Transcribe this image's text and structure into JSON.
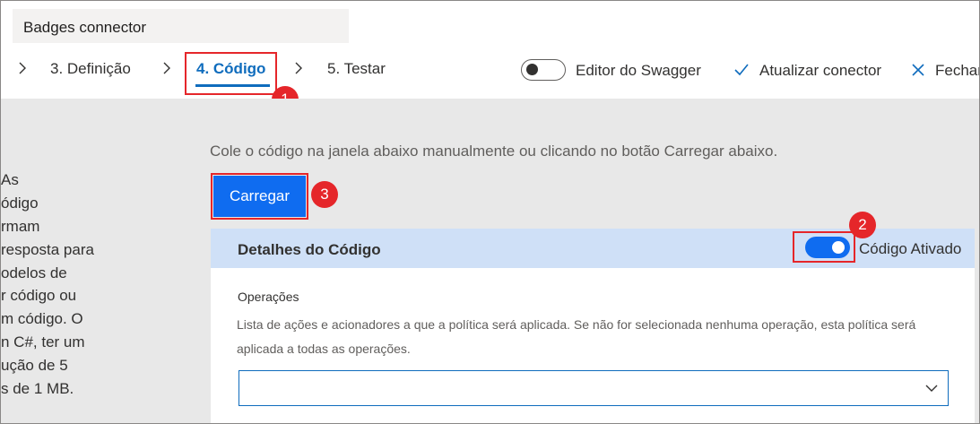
{
  "window": {
    "title": "Badges connector"
  },
  "steps": [
    {
      "label": "3. Definição",
      "active": false
    },
    {
      "label": "4. Código",
      "active": true
    },
    {
      "label": "5. Testar",
      "active": false
    }
  ],
  "commands": {
    "swagger_label": "Editor do Swagger",
    "swagger_on": false,
    "update_label": "Atualizar conector",
    "close_label": "Fechar"
  },
  "callouts": [
    "1",
    "2",
    "3"
  ],
  "left_panel": {
    "lines": [
      "As",
      "ódigo",
      "rmam",
      "resposta para",
      "odelos de",
      "r código ou",
      "m código. O",
      "n C#, ter um",
      "ução de 5",
      "s de 1 MB."
    ]
  },
  "main": {
    "instructions": "Cole o código na janela abaixo manualmente ou clicando no botão Carregar abaixo.",
    "upload_label": "Carregar",
    "details": {
      "title": "Detalhes do Código",
      "toggle_label": "Código Ativado",
      "toggle_on": true,
      "operations_label": "Operações",
      "operations_desc": "Lista de ações e acionadores a que a política será aplicada. Se não for selecionada nenhuma operação, esta política será aplicada a todas as operações.",
      "operations_value": ""
    }
  },
  "colors": {
    "accent": "#0f6cbd",
    "button": "#0f6cf0",
    "callout": "#e5262a",
    "header_bg": "#cfe0f7",
    "content_bg": "#e8e8e8"
  }
}
